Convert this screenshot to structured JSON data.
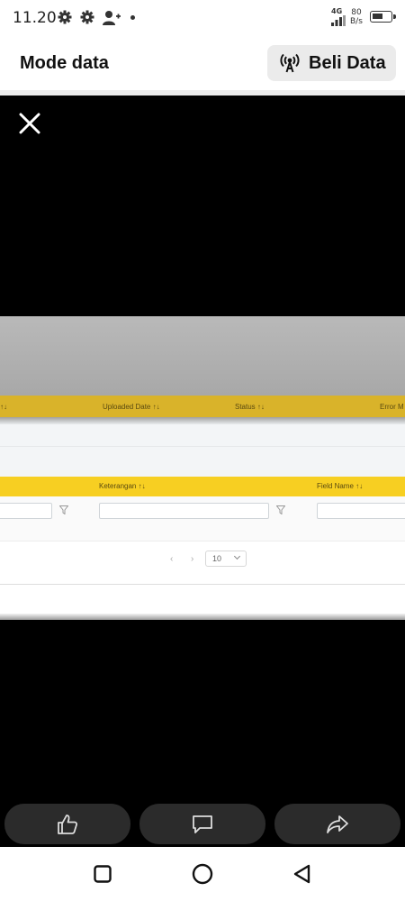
{
  "status_bar": {
    "time": "11.20",
    "network": "4G",
    "speed_value": "80",
    "speed_unit": "B/s",
    "icons": [
      "settings-icon",
      "settings-icon",
      "person-add-icon",
      "signal-icon",
      "battery-icon"
    ]
  },
  "header": {
    "title": "Mode data",
    "buy_button_label": "Beli Data",
    "buy_button_icon": "antenna-icon"
  },
  "media": {
    "top_table_headers": [
      "↑↓",
      "Uploaded Date ↑↓",
      "Status ↑↓",
      "Error M"
    ],
    "bottom_table_headers": [
      "Keterangan ↑↓",
      "Field Name ↑↓"
    ],
    "pagination": {
      "prev": "‹",
      "next": "›",
      "page_size": "10"
    },
    "colors": {
      "header_yellow": "#f7cf22",
      "header_dark_yellow": "#d9b32a"
    }
  },
  "actions": {
    "like_icon": "thumbs-up-icon",
    "comment_icon": "comment-icon",
    "share_icon": "share-icon"
  },
  "navigation": [
    "recent-apps-icon",
    "home-icon",
    "back-icon"
  ]
}
